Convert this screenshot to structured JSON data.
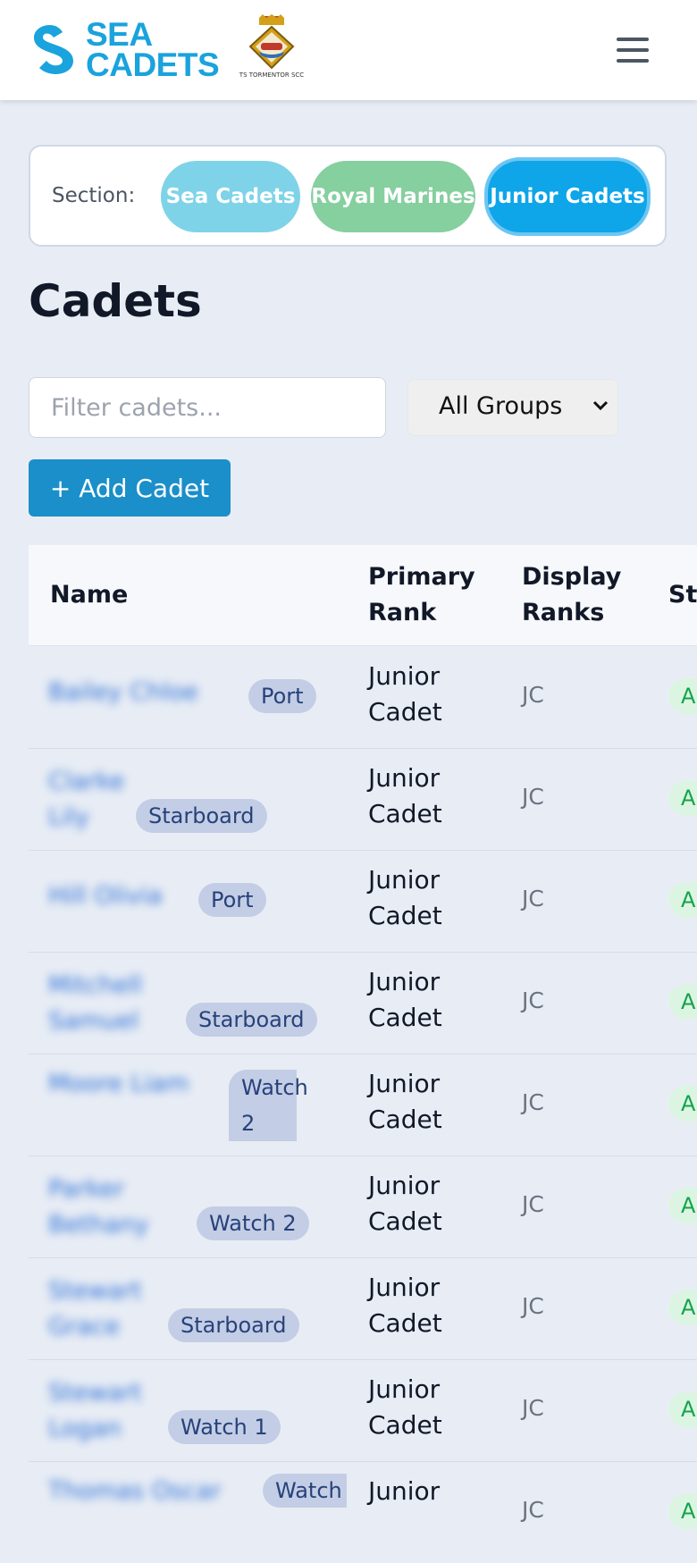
{
  "header": {
    "logo_line1": "SEA",
    "logo_line2": "CADETS",
    "crest_caption": "TS TORMENTOR SCC"
  },
  "section": {
    "label": "Section:",
    "options": [
      "Sea Cadets",
      "Royal Marines",
      "Junior Cadets"
    ],
    "selected": "Junior Cadets"
  },
  "page": {
    "title": "Cadets"
  },
  "filter": {
    "placeholder": "Filter cadets..."
  },
  "group_filter": {
    "selected": "All Groups"
  },
  "add_button": {
    "label": "+ Add Cadet"
  },
  "table": {
    "columns": [
      "Name",
      "Primary Rank",
      "Display Ranks",
      "St"
    ],
    "rows": [
      {
        "name": "Bailey Chloe",
        "group": "Port",
        "primary_rank": "Junior Cadet",
        "display_ranks": "JC",
        "status": "A"
      },
      {
        "name": "Clarke Lily",
        "group": "Starboard",
        "primary_rank": "Junior Cadet",
        "display_ranks": "JC",
        "status": "A"
      },
      {
        "name": "Hill Olivia",
        "group": "Port",
        "primary_rank": "Junior Cadet",
        "display_ranks": "JC",
        "status": "A"
      },
      {
        "name": "Mitchell Samuel",
        "group": "Starboard",
        "primary_rank": "Junior Cadet",
        "display_ranks": "JC",
        "status": "A"
      },
      {
        "name": "Moore Liam",
        "group": "Watch 2",
        "primary_rank": "Junior Cadet",
        "display_ranks": "JC",
        "status": "A"
      },
      {
        "name": "Parker Bethany",
        "group": "Watch 2",
        "primary_rank": "Junior Cadet",
        "display_ranks": "JC",
        "status": "A"
      },
      {
        "name": "Stewart Grace",
        "group": "Starboard",
        "primary_rank": "Junior Cadet",
        "display_ranks": "JC",
        "status": "A"
      },
      {
        "name": "Stewart Logan",
        "group": "Watch 1",
        "primary_rank": "Junior Cadet",
        "display_ranks": "JC",
        "status": "A"
      },
      {
        "name": "Thomas Oscar",
        "group": "Watch",
        "primary_rank": "Junior",
        "display_ranks": "JC",
        "status": "A"
      }
    ]
  },
  "colors": {
    "accent": "#0ea5e9",
    "brand": "#1aa3dc",
    "sea_cadets_pill": "#7fd3e8",
    "royal_marines_pill": "#86cf9f",
    "badge_bg": "#c3cde5",
    "status_green": "#dcf5e3"
  }
}
